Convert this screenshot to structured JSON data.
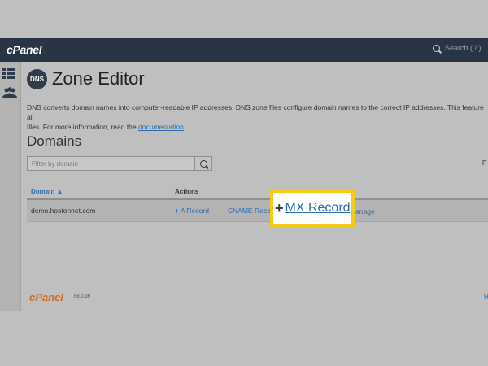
{
  "topbar": {
    "logo": "cPanel",
    "search_placeholder": "Search ( / )"
  },
  "sidebar": {
    "items": [
      {
        "name": "apps-grid",
        "icon": "grid-icon"
      },
      {
        "name": "users",
        "icon": "users-icon"
      }
    ]
  },
  "page": {
    "icon_text": "DNS",
    "title": "Zone Editor",
    "description_line1": "DNS converts domain names into computer-readable IP addresses. DNS zone files configure domain names to the correct IP addresses. This feature al",
    "description_line2_prefix": "files. For more information, read the ",
    "description_link": "documentation",
    "description_line2_suffix": "."
  },
  "domains": {
    "title": "Domains",
    "filter_placeholder": "Filter by domain",
    "right_label": "P",
    "columns": {
      "domain": "Domain ▲",
      "actions": "Actions"
    },
    "rows": [
      {
        "domain": "demo.hostonnet.com",
        "actions": [
          "A Record",
          "CNAME Record"
        ],
        "manage": "Manage"
      }
    ],
    "manage_visible": "anage"
  },
  "highlight": {
    "plus": "+",
    "label": "MX Record"
  },
  "footer": {
    "logo": "cPanel",
    "version": "68.0.39",
    "right": "H"
  },
  "colors": {
    "topbar": "#283544",
    "accent": "#2a6eb0",
    "highlight_border": "#f1cc18",
    "footer_logo": "#d2691e"
  }
}
